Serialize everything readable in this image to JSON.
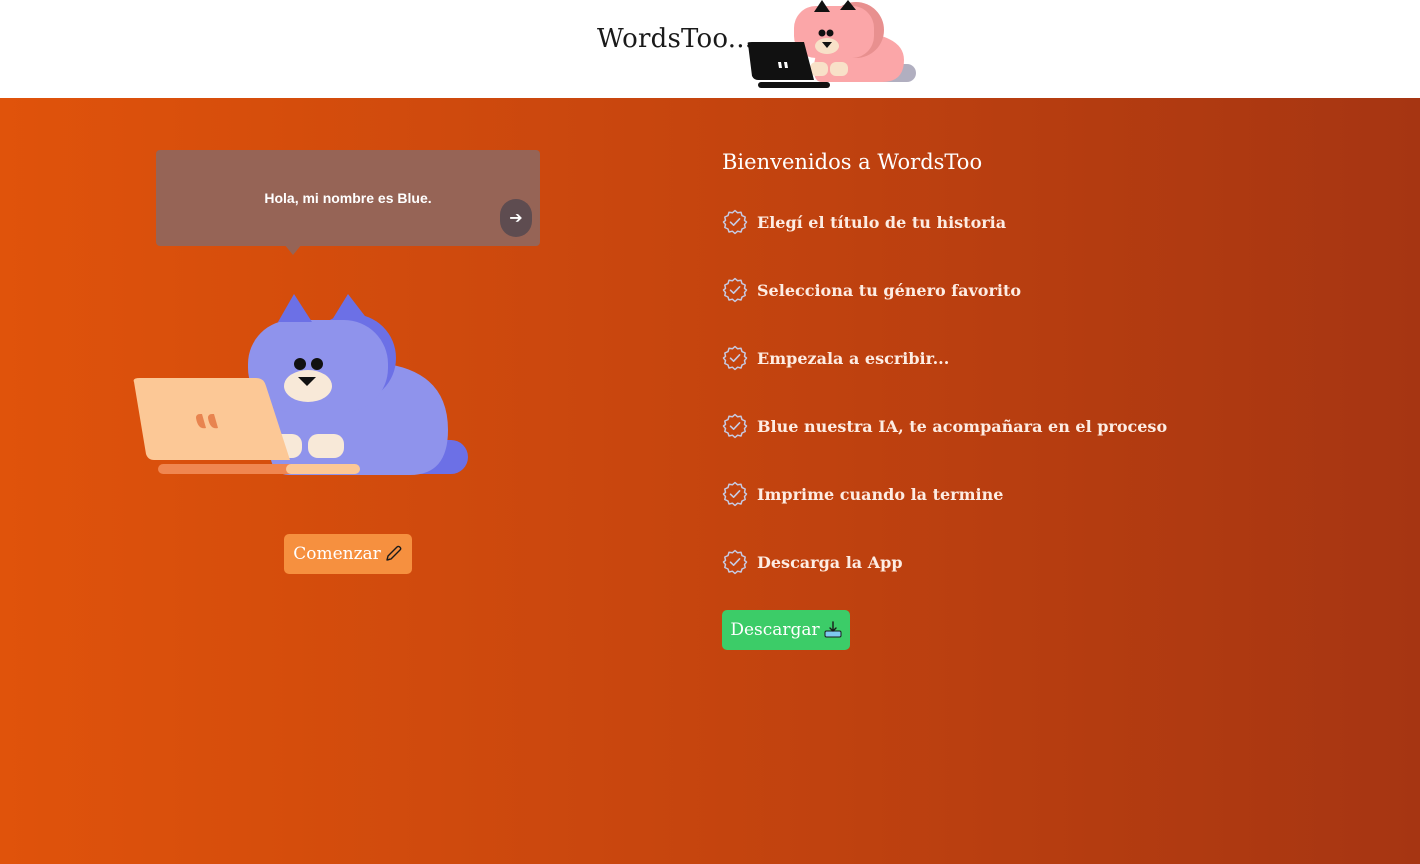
{
  "header": {
    "brand": "WordsToo...",
    "mascot_icon": "cat-with-laptop-icon"
  },
  "hero": {
    "bubble_text": "Hola, mi nombre es Blue.",
    "next_icon": "arrow-right-icon",
    "mascot_icon": "blue-cat-laptop-icon",
    "start_button": "Comenzar",
    "start_icon": "pencil-icon"
  },
  "steps": {
    "title": "Bienvenidos a WordsToo",
    "check_icon": "check-badge-icon",
    "items": [
      "Elegí el título de tu historia",
      "Selecciona tu género favorito",
      "Empezala a escribir...",
      "Blue nuestra IA, te acompañara en el proceso",
      "Imprime cuando la termine",
      "Descarga la App"
    ],
    "download_button": "Descargar",
    "download_icon": "download-tray-icon"
  },
  "colors": {
    "bg_start": "#e0530b",
    "bg_end": "#a63512",
    "bubble": "#966456",
    "start_button": "#f6903f",
    "download_button": "#3ccc68",
    "cat_blue": "#8f93ec",
    "cat_pink": "#fba6a8"
  }
}
